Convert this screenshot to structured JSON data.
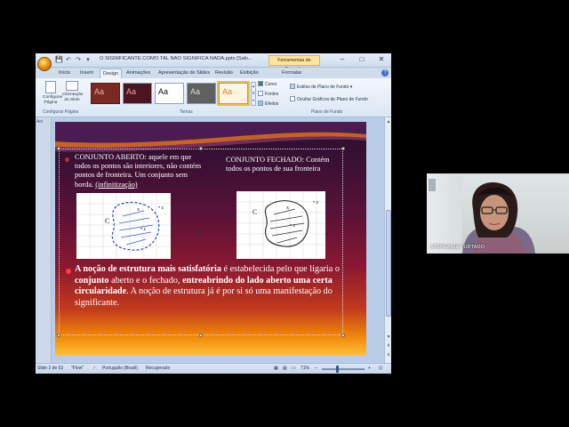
{
  "window": {
    "title": "O SIGNIFICANTE COMO TAL NÃO SIGNIFICA NADA.pptx [Salv...",
    "contextual_tab": "Ferramentas de Desenho",
    "context_format_tab": "Formatar",
    "qat": [
      "💾",
      "↶",
      "↷",
      "▾"
    ]
  },
  "ribbon": {
    "tabs": [
      "Início",
      "Inserir",
      "Design",
      "Animações",
      "Apresentação de Slides",
      "Revisão",
      "Exibição"
    ],
    "active_tab": "Design",
    "page_setup": {
      "setup_label": "Configurar Página",
      "orientation_label": "Orientação do Slide",
      "group_label": "Configurar Página"
    },
    "themes": {
      "items": [
        "Aa",
        "Aa",
        "Aa",
        "Aa",
        "Aa"
      ],
      "group_label": "Temas"
    },
    "theme_options": {
      "colors": "Cores",
      "fonts": "Fontes",
      "effects": "Efeitos"
    },
    "background": {
      "styles": "Estilos de Plano de Fundo",
      "hide_graphics": "Ocultar Gráficos de Plano de Fundo",
      "group_label": "Plano de Fundo"
    },
    "help": "?"
  },
  "left_panel": {
    "label": "Ani"
  },
  "slide": {
    "left_box": {
      "title": "CONJUNTO ABERTO",
      "text": ": aquele em que todos os pontos são interiores, não contém pontos de fronteira. Um conjunto sem borda.",
      "term": "(infinitização)"
    },
    "right_box": {
      "title": "CONJUNTO FECHADO",
      "text": ": Contém todos os pontos de sua fronteira"
    },
    "figure_left": {
      "label_c": "C",
      "label_x": "x",
      "label_e1": "• ε",
      "label_e2": "• ε"
    },
    "figure_right": {
      "label_c": "C",
      "label_x": "x",
      "label_e1": "• ε",
      "label_e2": "• ε"
    },
    "main": {
      "part1": "A noção de estrutura mais satisfatória",
      "part2": " é estabelecida pelo que ligaria o ",
      "part3": "conjunto",
      "part4": " aberto e o fechado, ",
      "part5": "entreabrindo do lado aberto uma certa circularidade",
      "part6": ". A noção de estrutura já é por si só uma manifestação do significante."
    }
  },
  "status": {
    "slide": "Slide 2 de 53",
    "theme": "\"Flow\"",
    "language": "Português (Brasil)",
    "recovered": "Recuperado",
    "zoom": "71%"
  },
  "webcam": {
    "name": "STEPHANIE FURTADO"
  },
  "colors": {
    "slide_top": "#2a0f2a",
    "slide_bottom": "#ffc23a",
    "bullet": "#c12a2a"
  }
}
